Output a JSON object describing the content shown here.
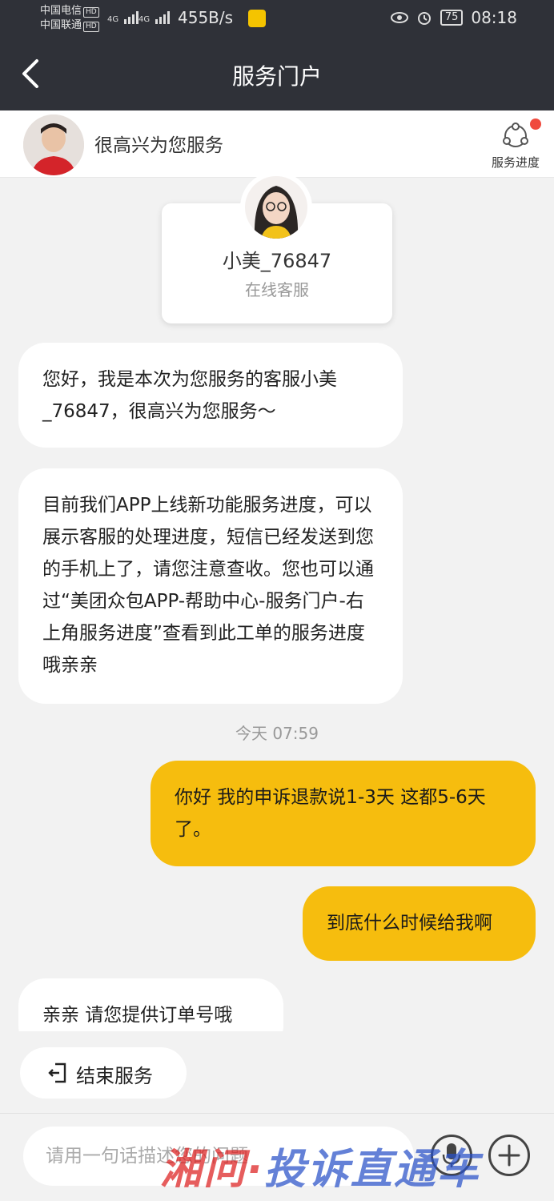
{
  "status_bar": {
    "carrier1": "中国电信",
    "carrier2": "中国联通",
    "hd": "HD",
    "net1": "4G",
    "net2": "4G",
    "speed": "455B/s",
    "battery": "75",
    "time": "08:18"
  },
  "header": {
    "title": "服务门户",
    "back_icon": "chevron-left-icon"
  },
  "service_bar": {
    "greeting": "很高兴为您服务",
    "progress_label": "服务进度",
    "progress_icon": "service-progress-icon",
    "badge_color": "#f04a3e"
  },
  "agent": {
    "name": "小美_76847",
    "role": "在线客服"
  },
  "messages": [
    {
      "side": "in",
      "text": "您好，我是本次为您服务的客服小美_76847，很高兴为您服务～"
    },
    {
      "side": "in",
      "text": "目前我们APP上线新功能服务进度，可以展示客服的处理进度，短信已经发送到您的手机上了，请您注意查收。您也可以通过“美团众包APP-帮助中心-服务门户-右上角服务进度”查看到此工单的服务进度哦亲亲"
    },
    {
      "side": "out",
      "text": "你好 我的申诉退款说1-3天 这都5-6天了。"
    },
    {
      "side": "out",
      "text": "到底什么时候给我啊"
    },
    {
      "side": "in",
      "text": "亲亲  请您提供订单号哦"
    }
  ],
  "timestamp": "今天 07:59",
  "end_service": {
    "label": "结束服务",
    "icon": "exit-icon"
  },
  "input": {
    "placeholder": "请用一句话描述您的问题",
    "voice_icon": "microphone-icon",
    "add_icon": "plus-icon"
  },
  "watermark": {
    "part1": "湘问·",
    "part2": "投诉直通车"
  },
  "colors": {
    "header_bg": "#2f3138",
    "outgoing_bubble": "#f6bd0e",
    "incoming_bubble": "#ffffff",
    "page_bg": "#f2f2f2"
  }
}
